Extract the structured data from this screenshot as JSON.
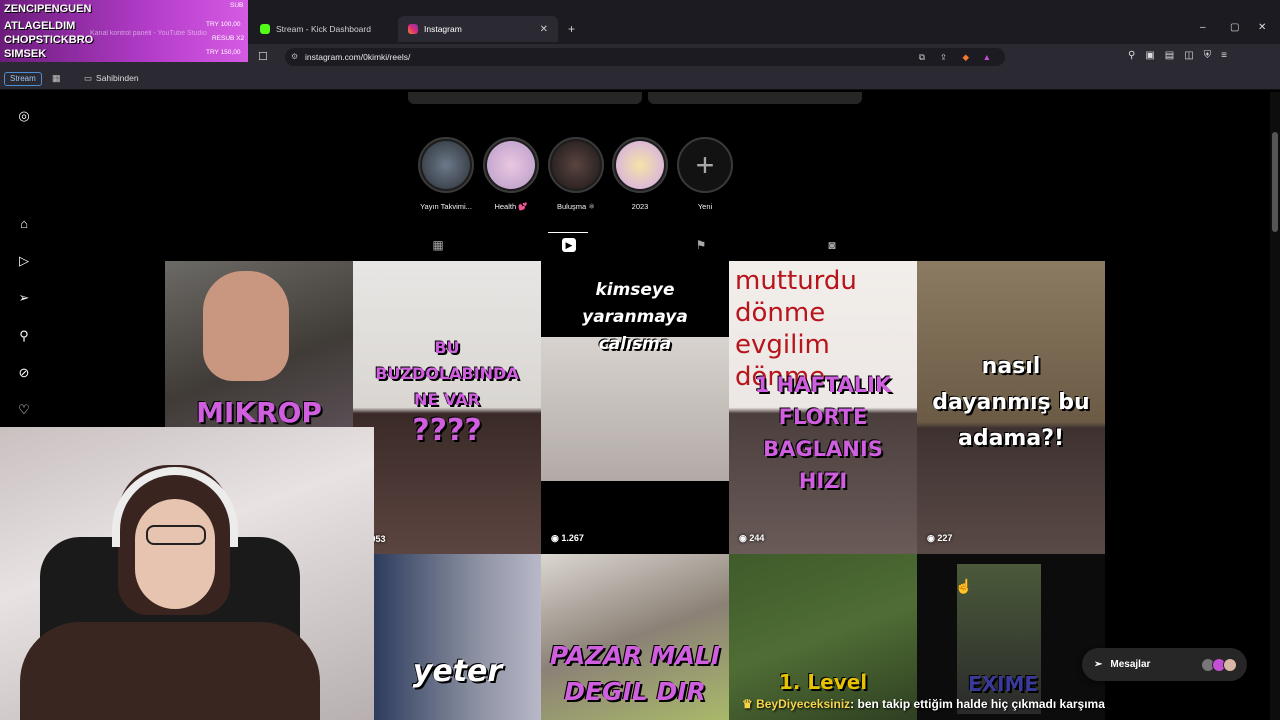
{
  "browser": {
    "tabs": [
      {
        "label": "Stream - Kick Dashboard",
        "active": false
      },
      {
        "label": "Instagram",
        "active": true
      }
    ],
    "url": "instagram.com/0kimki/reels/",
    "bookmarks": {
      "stream_label": "Stream",
      "folder_label": "Sahibinden"
    }
  },
  "stream_overlay": {
    "names": [
      "ZENCIPENGUEN",
      "ATLAGELDIM",
      "CHOPSTICKBRO",
      "SIMSEK"
    ],
    "right_labels": [
      "SUB",
      "TRY 100,00",
      "RESUB X2",
      "TRY 150,00"
    ],
    "faint_text": "Kanal kontrol paneli - YouTube Studio"
  },
  "highlights": [
    {
      "label": "Yayın Takvimi..."
    },
    {
      "label": "Health 💕"
    },
    {
      "label": "Buluşma ⚛"
    },
    {
      "label": "2023"
    },
    {
      "label": "Yeni"
    }
  ],
  "reels": [
    {
      "caption": "MIKROP",
      "views": ""
    },
    {
      "caption": "BU BUZDOLABINDA NE VAR",
      "sub_caption": "????",
      "views": "1.953"
    },
    {
      "caption": "kimseye yaranmaya calısma",
      "views": "1.267"
    },
    {
      "caption": "1 HAFTALIK FLORTE BAGLANIS HIZI",
      "bg_text": "mutturdu dönme evgilim dönme",
      "views": "244"
    },
    {
      "caption": "nasıl dayanmış bu adama?!",
      "views": "227"
    },
    {
      "caption": "yeter",
      "views": ""
    },
    {
      "caption": "PAZAR MALI DEGIL DIR",
      "views": ""
    },
    {
      "caption": "1. Level",
      "views": ""
    },
    {
      "caption": "EXIME",
      "views": ""
    }
  ],
  "messages_button": {
    "label": "Mesajlar"
  },
  "chat": {
    "user": "BeyDiyeceksiniz",
    "text": ": ben takip ettiğim halde hiç çıkmadı karşıma"
  },
  "colors": {
    "overlay": "#b33cc9",
    "accent_purple": "#c24fd6",
    "chat_user": "#f5d34b"
  }
}
